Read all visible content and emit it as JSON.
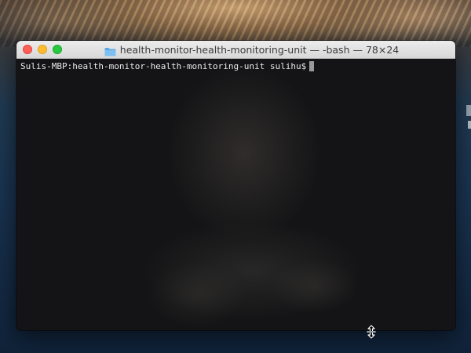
{
  "window": {
    "title": "health-monitor-health-monitoring-unit — -bash — 78×24"
  },
  "terminal": {
    "prompt": "Sulis-MBP:health-monitor-health-monitoring-unit sulihu$"
  },
  "colors": {
    "close": "#fe5f57",
    "minimize": "#febc2e",
    "maximize": "#28c840",
    "folder": "#5aa9e6",
    "terminal_bg": "#141416",
    "terminal_text": "#e8e8e8"
  },
  "icons": {
    "folder": "folder-icon",
    "resize_cursor": "vertical-resize-cursor-icon"
  }
}
